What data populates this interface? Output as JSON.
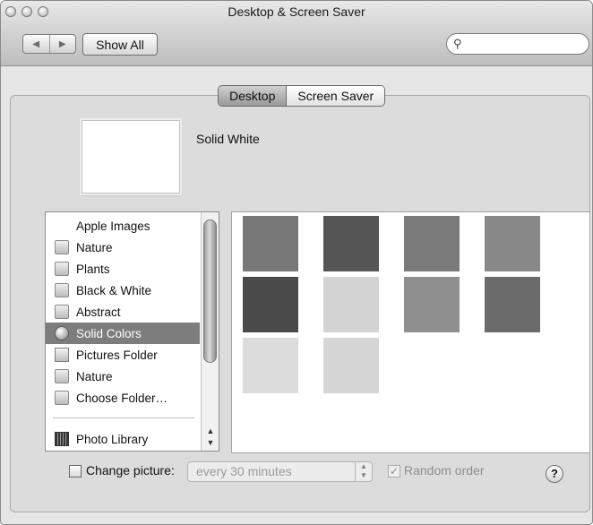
{
  "window": {
    "title": "Desktop & Screen Saver"
  },
  "toolbar": {
    "back_glyph": "◀",
    "forward_glyph": "▶",
    "show_all_label": "Show All",
    "search_icon": "search-icon",
    "search_value": ""
  },
  "tabs": [
    {
      "label": "Desktop",
      "selected": true
    },
    {
      "label": "Screen Saver",
      "selected": false
    }
  ],
  "preview": {
    "name": "Solid White",
    "color": "#ffffff"
  },
  "sources": [
    {
      "label": "Apple Images",
      "icon": "apple-icon",
      "selected": false
    },
    {
      "label": "Nature",
      "icon": "folder-icon",
      "selected": false
    },
    {
      "label": "Plants",
      "icon": "folder-icon",
      "selected": false
    },
    {
      "label": "Black & White",
      "icon": "folder-icon",
      "selected": false
    },
    {
      "label": "Abstract",
      "icon": "folder-icon",
      "selected": false
    },
    {
      "label": "Solid Colors",
      "icon": "color-disc-icon",
      "selected": true
    },
    {
      "label": "Pictures Folder",
      "icon": "pictures-folder-icon",
      "selected": false
    },
    {
      "label": "Nature",
      "icon": "folder-icon",
      "selected": false
    },
    {
      "label": "Choose Folder…",
      "icon": "folder-icon",
      "selected": false
    },
    {
      "label": "Photo Library",
      "icon": "photo-library-icon",
      "selected": false
    }
  ],
  "swatches": [
    "#787878",
    "#555555",
    "#7a7a7a",
    "#888888",
    "#4a4a4a",
    "#d3d3d3",
    "#8f8f8f",
    "#6b6b6b",
    "#dcdcdc",
    "#d6d6d6"
  ],
  "bottom": {
    "change_picture_label": "Change picture:",
    "change_picture_checked": false,
    "interval_value": "every 30 minutes",
    "random_order_label": "Random order",
    "random_order_checked": true,
    "help_label": "?"
  }
}
